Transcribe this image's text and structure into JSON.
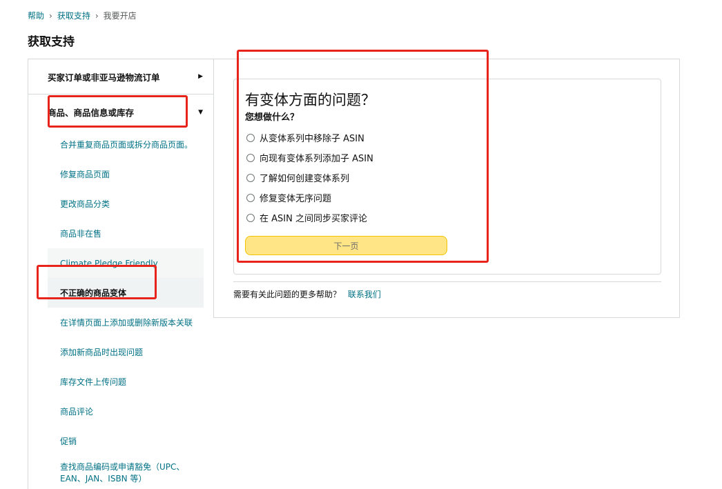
{
  "breadcrumb": {
    "items": [
      "帮助",
      "获取支持",
      "我要开店"
    ],
    "separator": "›"
  },
  "page_title": "获取支持",
  "sidebar": {
    "categories": [
      {
        "label": "买家订单或非亚马逊物流订单",
        "caret": "▶"
      },
      {
        "label": "商品、商品信息或库存",
        "caret": "▼"
      }
    ],
    "items": [
      {
        "label": "合并重复商品页面或拆分商品页面。"
      },
      {
        "label": "修复商品页面"
      },
      {
        "label": "更改商品分类"
      },
      {
        "label": "商品非在售"
      },
      {
        "label": "Climate Pledge Friendly"
      },
      {
        "label": "不正确的商品变体"
      },
      {
        "label": "在详情页面上添加或删除新版本关联"
      },
      {
        "label": "添加新商品时出现问题"
      },
      {
        "label": "库存文件上传问题"
      },
      {
        "label": "商品评论"
      },
      {
        "label": "促销"
      },
      {
        "label": "查找商品编码或申请豁免（UPC、EAN、JAN、ISBN 等）"
      }
    ],
    "selected_item": "不正确的商品变体"
  },
  "main": {
    "question_title": "有变体方面的问题？",
    "question_subtitle": "您想做什么？",
    "options": [
      {
        "label": "从变体系列中移除子 ASIN"
      },
      {
        "label": "向现有变体系列添加子 ASIN"
      },
      {
        "label": "了解如何创建变体系列"
      },
      {
        "label": "修复变体无序问题"
      },
      {
        "label": "在 ASIN 之间同步买家评论"
      }
    ],
    "next_button": "下一页",
    "help_text": "需要有关此问题的更多帮助？",
    "contact_link": "联系我们"
  },
  "colors": {
    "link": "#007185",
    "annotation": "#e8231b",
    "button_bg": "#ffe586",
    "border": "#d5d9d9"
  }
}
